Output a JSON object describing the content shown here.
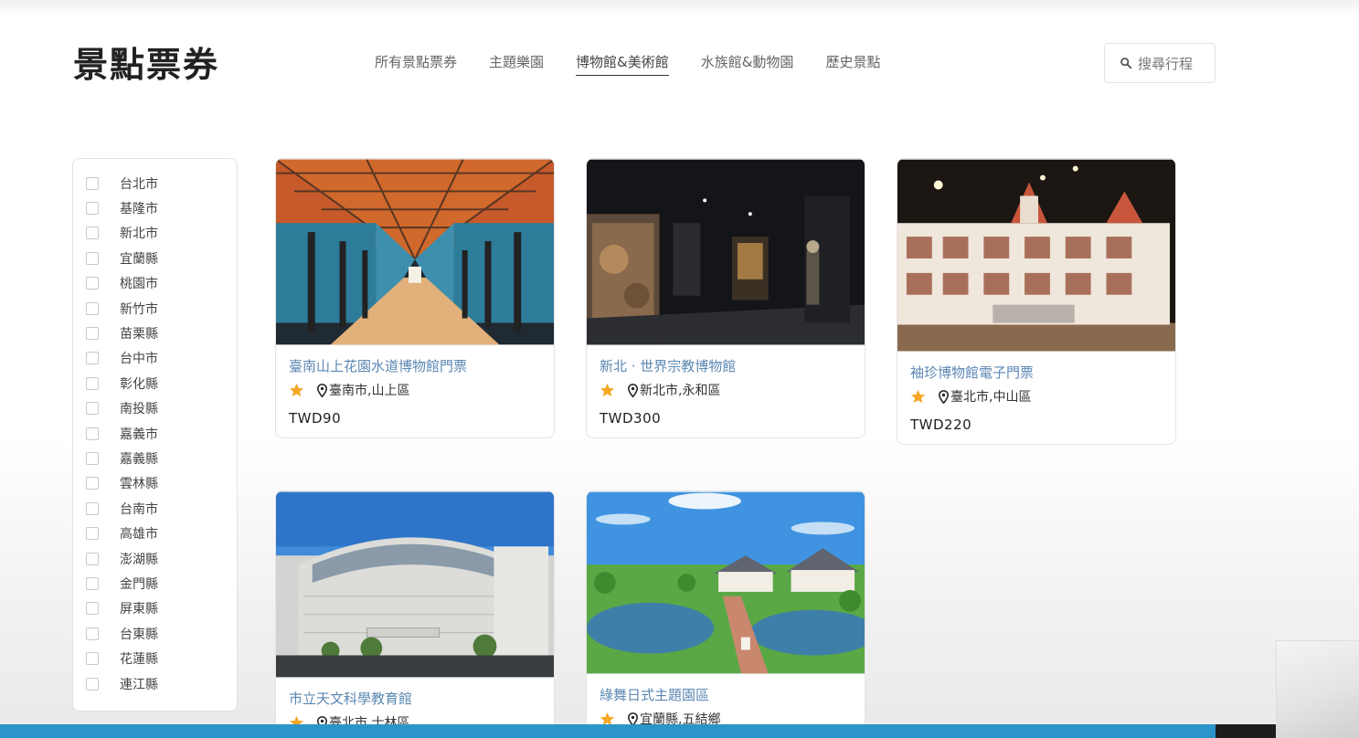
{
  "brand": {
    "title": "景點票券"
  },
  "nav": {
    "items": [
      {
        "label": "所有景點票券"
      },
      {
        "label": "主題樂園"
      },
      {
        "label": "博物館&美術館"
      },
      {
        "label": "水族館&動物園"
      },
      {
        "label": "歷史景點"
      }
    ],
    "active_index": 2
  },
  "search": {
    "label": "搜尋行程",
    "icon": "search-icon"
  },
  "sidebar": {
    "cities": [
      "台北市",
      "基隆市",
      "新北市",
      "宜蘭縣",
      "桃園市",
      "新竹市",
      "苗栗縣",
      "台中市",
      "彰化縣",
      "南投縣",
      "嘉義市",
      "嘉義縣",
      "雲林縣",
      "台南市",
      "高雄市",
      "澎湖縣",
      "金門縣",
      "屏東縣",
      "台東縣",
      "花蓮縣",
      "連江縣"
    ]
  },
  "cards": [
    {
      "title": "臺南山上花園水道博物館門票",
      "location": "臺南市,山上區",
      "price": "TWD90"
    },
    {
      "title": "新北 · 世界宗教博物館",
      "location": "新北市,永和區",
      "price": "TWD300"
    },
    {
      "title": "袖珍博物館電子門票",
      "location": "臺北市,中山區",
      "price": "TWD220"
    },
    {
      "title": "市立天文科學教育館",
      "location": "臺北市,士林區",
      "price": ""
    },
    {
      "title": "綠舞日式主題園區",
      "location": "宜蘭縣,五結鄉",
      "price": ""
    }
  ],
  "colors": {
    "title_link": "#5b87b3",
    "star": "#f5a623",
    "bottom_bar": "#2b95c9"
  }
}
